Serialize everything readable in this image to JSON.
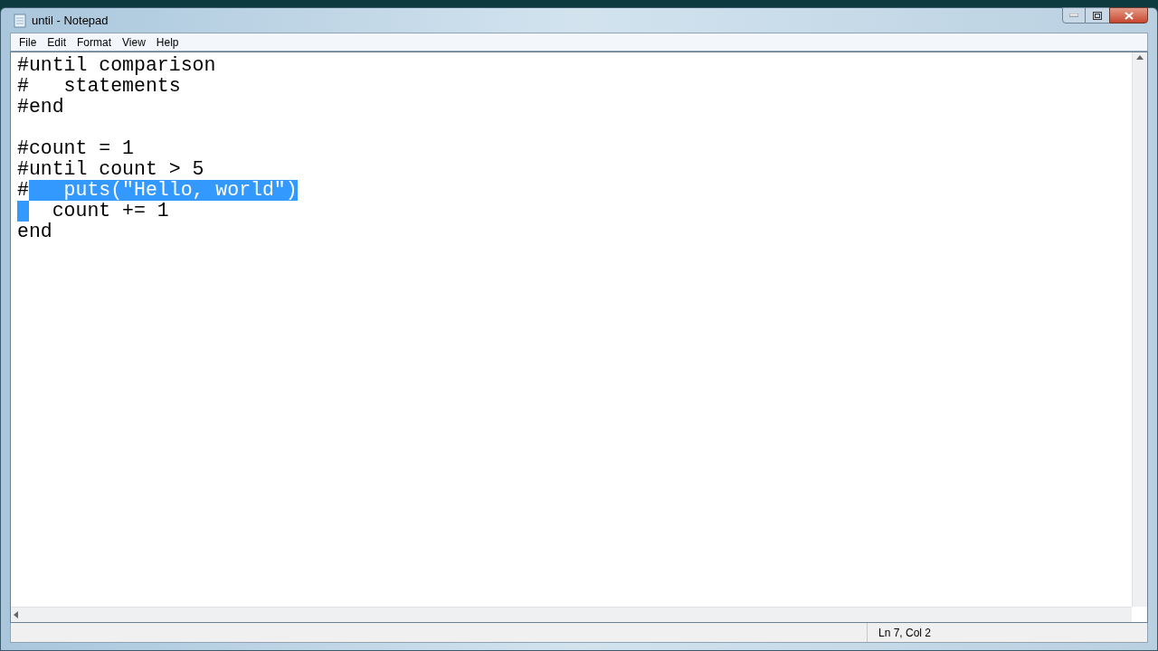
{
  "window": {
    "title": "until - Notepad"
  },
  "menu": [
    "File",
    "Edit",
    "Format",
    "View",
    "Help"
  ],
  "editor": {
    "lines": [
      {
        "kind": "code",
        "lead_selected": false,
        "segments": [
          {
            "text": "#until comparison",
            "selected": false
          }
        ]
      },
      {
        "kind": "code",
        "lead_selected": false,
        "segments": [
          {
            "text": "#   statements",
            "selected": false
          }
        ]
      },
      {
        "kind": "code",
        "lead_selected": false,
        "segments": [
          {
            "text": "#end",
            "selected": false
          }
        ]
      },
      {
        "kind": "blank"
      },
      {
        "kind": "code",
        "lead_selected": false,
        "segments": [
          {
            "text": "#count = 1",
            "selected": false
          }
        ]
      },
      {
        "kind": "code",
        "lead_selected": false,
        "segments": [
          {
            "text": "#until count > 5",
            "selected": false
          }
        ]
      },
      {
        "kind": "code",
        "lead_selected": false,
        "segments": [
          {
            "text": "#",
            "selected": false
          },
          {
            "text": "   puts(\"Hello, world\")",
            "selected": true
          }
        ]
      },
      {
        "kind": "code",
        "lead_selected": true,
        "segments": [
          {
            "text": "  count += 1",
            "selected": false
          }
        ]
      },
      {
        "kind": "code",
        "lead_selected": false,
        "segments": [
          {
            "text": "end",
            "selected": false
          }
        ]
      }
    ]
  },
  "status_bar": {
    "position": "Ln 7, Col 2"
  }
}
